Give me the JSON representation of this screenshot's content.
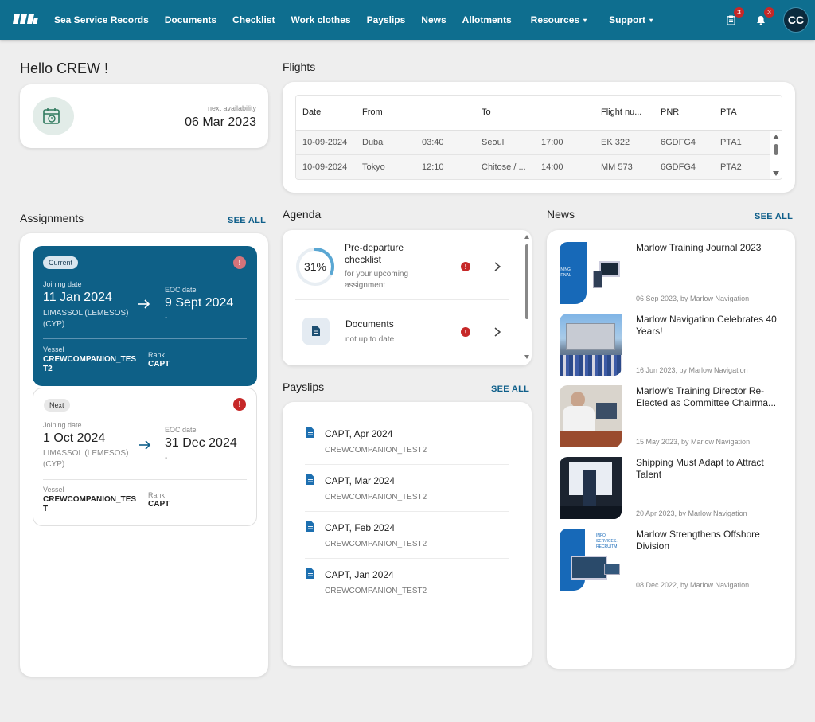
{
  "nav": {
    "logo": "marlow-logo-icon",
    "links": [
      {
        "label": "Sea Service Records",
        "dropdown": false
      },
      {
        "label": "Documents",
        "dropdown": false
      },
      {
        "label": "Checklist",
        "dropdown": false
      },
      {
        "label": "Work clothes",
        "dropdown": false
      },
      {
        "label": "Payslips",
        "dropdown": false
      },
      {
        "label": "News",
        "dropdown": false
      },
      {
        "label": "Allotments",
        "dropdown": false
      },
      {
        "label": "Resources",
        "dropdown": true
      },
      {
        "label": "Support",
        "dropdown": true
      }
    ],
    "clipboard_badge": "3",
    "bell_badge": "3",
    "avatar_initials": "CC",
    "caret": "▾"
  },
  "hello": {
    "greeting": "Hello CREW !",
    "availability_label": "next availability",
    "availability_date": "06 Mar 2023"
  },
  "flights": {
    "title": "Flights",
    "headers": [
      "Date",
      "From",
      "To",
      "Flight nu...",
      "PNR",
      "PTA"
    ],
    "rows": [
      {
        "date": "10-09-2024",
        "from": "Dubai",
        "dep_time": "03:40",
        "to": "Seoul",
        "arr_time": "17:00",
        "flight": "EK 322",
        "pnr": "6GDFG4",
        "pta": "PTA1"
      },
      {
        "date": "10-09-2024",
        "from": "Tokyo",
        "dep_time": "12:10",
        "to": "Chitose / ...",
        "arr_time": "14:00",
        "flight": "MM 573",
        "pnr": "6GDFG4",
        "pta": "PTA2"
      }
    ]
  },
  "assignments": {
    "title": "Assignments",
    "see_all": "SEE ALL",
    "current": {
      "chip": "Current",
      "joining_label": "Joining date",
      "joining_date": "11 Jan 2024",
      "joining_place": "LIMASSOL (LEMESOS) (CYP)",
      "eoc_label": "EOC date",
      "eoc_date": "9 Sept 2024",
      "eoc_sub": "-",
      "vessel_label": "Vessel",
      "vessel": "CREWCOMPANION_TEST2",
      "rank_label": "Rank",
      "rank": "CAPT",
      "alert": "!"
    },
    "next": {
      "chip": "Next",
      "joining_label": "Joining date",
      "joining_date": "1 Oct 2024",
      "joining_place": "LIMASSOL (LEMESOS) (CYP)",
      "eoc_label": "EOC date",
      "eoc_date": "31 Dec 2024",
      "eoc_sub": "-",
      "vessel_label": "Vessel",
      "vessel": "CREWCOMPANION_TEST",
      "rank_label": "Rank",
      "rank": "CAPT",
      "alert": "!"
    }
  },
  "agenda": {
    "title": "Agenda",
    "items": [
      {
        "title": "Pre-departure checklist",
        "subtitle": "for your upcoming assignment",
        "progress": "31%",
        "progress_value": 0.31,
        "alert": "!"
      },
      {
        "title": "Documents",
        "subtitle": "not up to date",
        "alert": "!"
      }
    ]
  },
  "payslips": {
    "title": "Payslips",
    "see_all": "SEE ALL",
    "items": [
      {
        "title": "CAPT, Apr 2024",
        "vessel": "CREWCOMPANION_TEST2"
      },
      {
        "title": "CAPT, Mar 2024",
        "vessel": "CREWCOMPANION_TEST2"
      },
      {
        "title": "CAPT, Feb 2024",
        "vessel": "CREWCOMPANION_TEST2"
      },
      {
        "title": "CAPT, Jan 2024",
        "vessel": "CREWCOMPANION_TEST2"
      }
    ]
  },
  "news": {
    "title": "News",
    "see_all": "SEE ALL",
    "items": [
      {
        "title": "Marlow Training Journal 2023",
        "meta": "06 Sep 2023, by Marlow Navigation",
        "thumb_text": "INING\nIRNAL"
      },
      {
        "title": "Marlow Navigation Celebrates 40 Years!",
        "meta": "16 Jun 2023, by Marlow Navigation"
      },
      {
        "title": "Marlow’s Training Director Re-Elected as Committee Chairma...",
        "meta": "15 May 2023, by Marlow Navigation"
      },
      {
        "title": "Shipping Must Adapt to Attract Talent",
        "meta": "20 Apr 2023, by Marlow Navigation"
      },
      {
        "title": "Marlow Strengthens Offshore Division",
        "meta": "08 Dec 2022, by Marlow Navigation",
        "thumb_text": "INFO.\nSERVICES.\nRECRUITM"
      }
    ]
  },
  "colors": {
    "primary": "#0e6e8f",
    "assignment_current": "#0e6087",
    "alert": "#c62828",
    "link": "#0f5f8a"
  }
}
